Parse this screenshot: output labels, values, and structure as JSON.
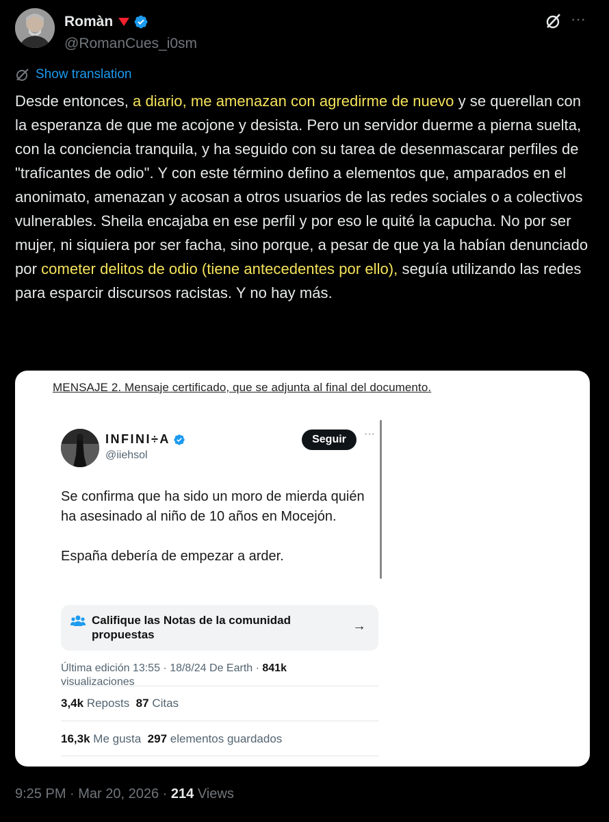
{
  "author": {
    "name": "Romàn",
    "handle": "@RomanCues_i0sm"
  },
  "translation_label": "Show translation",
  "post": {
    "t1": "Desde entonces, ",
    "h1": "a diario, me amenazan con agredirme de nuevo",
    "t2": " y se querellan con la esperanza de que me acojone y desista. Pero un servidor duerme a pierna suelta, con la conciencia tranquila, y ha seguido con su tarea de desenmascarar perfiles de \"traficantes de odio\". Y con este término defino a elementos que, amparados en el anonimato, amenazan y acosan a otros usuarios de las redes sociales o a colectivos vulnerables. Sheila encajaba en ese perfil y por eso le quité la capucha. No por ser mujer, ni siquiera por ser facha, sino porque, a pesar de que ya la habían denunciado por ",
    "h2": "cometer delitos de odio (tiene antecedentes por ello),",
    "t3": " seguía utilizando las redes para esparcir discursos racistas. Y no hay más."
  },
  "embed": {
    "caption": "MENSAJE 2. Mensaje certificado, que se adjunta al final del documento.",
    "name": "INFINI÷A",
    "handle": "@iiehsol",
    "follow_label": "Seguir",
    "text_p1": "Se confirma que ha sido un moro de mierda quién ha asesinado al niño de 10 años en Mocejón.",
    "text_p2": "España debería de empezar a arder.",
    "notes_label": "Califique las Notas de la comunidad propuestas",
    "meta_prefix": "Última edición 13:55 · 18/8/24  De Earth · ",
    "views_count": "841k",
    "views_label": "visualizaciones",
    "reposts_count": "3,4k",
    "reposts_label": "Reposts",
    "quotes_count": "87",
    "quotes_label": "Citas",
    "likes_count": "16,3k",
    "likes_label": "Me gusta",
    "saves_count": "297",
    "saves_label": "elementos guardados"
  },
  "footer": {
    "timestamp": "9:25 PM · Mar 20, 2026 · ",
    "views_count": "214",
    "views_label": "Views"
  }
}
